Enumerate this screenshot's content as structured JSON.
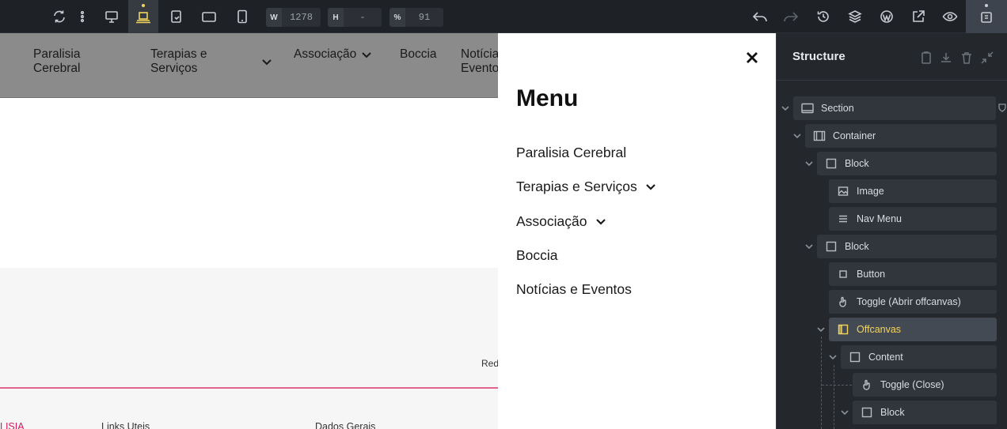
{
  "toolbar": {
    "width_label": "W",
    "width_value": "1278",
    "height_label": "H",
    "height_value": "-",
    "zoom_label": "%",
    "zoom_value": "91",
    "accent_color": "#f2d45c"
  },
  "header_nav": [
    {
      "label": "Paralisia\nCerebral",
      "has_dropdown": false
    },
    {
      "label": "Terapias e\nServiços",
      "has_dropdown": true
    },
    {
      "label": "Associação",
      "has_dropdown": true
    },
    {
      "label": "Boccia",
      "has_dropdown": false
    },
    {
      "label": "Notícia\nEvento",
      "has_dropdown": false
    }
  ],
  "page": {
    "partial_text": "Red",
    "footer_col1": "LISIA",
    "footer_col2": "Links Uteis",
    "footer_col3": "Dados Gerais"
  },
  "offcanvas": {
    "title": "Menu",
    "items": [
      {
        "label": "Paralisia Cerebral",
        "has_dropdown": false
      },
      {
        "label": "Terapias e Serviços",
        "has_dropdown": true
      },
      {
        "label": "Associação",
        "has_dropdown": true
      },
      {
        "label": "Boccia",
        "has_dropdown": false
      },
      {
        "label": "Notícias e Eventos",
        "has_dropdown": false
      }
    ]
  },
  "structure": {
    "title": "Structure",
    "tree": [
      {
        "label": "Section",
        "icon": "section-icon",
        "depth": 0,
        "expanded": true
      },
      {
        "label": "Container",
        "icon": "container-icon",
        "depth": 1,
        "expanded": true
      },
      {
        "label": "Block",
        "icon": "block-icon",
        "depth": 2,
        "expanded": true
      },
      {
        "label": "Image",
        "icon": "image-icon",
        "depth": 3,
        "expanded": false
      },
      {
        "label": "Nav Menu",
        "icon": "menu-icon",
        "depth": 3,
        "expanded": false
      },
      {
        "label": "Block",
        "icon": "block-icon",
        "depth": 2,
        "expanded": true
      },
      {
        "label": "Button",
        "icon": "button-icon",
        "depth": 3,
        "expanded": false
      },
      {
        "label": "Toggle (Abrir offcanvas)",
        "icon": "toggle-hand-icon",
        "depth": 3,
        "expanded": false
      },
      {
        "label": "Offcanvas",
        "icon": "offcanvas-icon",
        "depth": 3,
        "expanded": true,
        "selected": true
      },
      {
        "label": "Content",
        "icon": "block-icon",
        "depth": 4,
        "expanded": true
      },
      {
        "label": "Toggle (Close)",
        "icon": "toggle-hand-icon",
        "depth": 5,
        "expanded": false
      },
      {
        "label": "Block",
        "icon": "block-icon",
        "depth": 5,
        "expanded": true
      }
    ]
  }
}
